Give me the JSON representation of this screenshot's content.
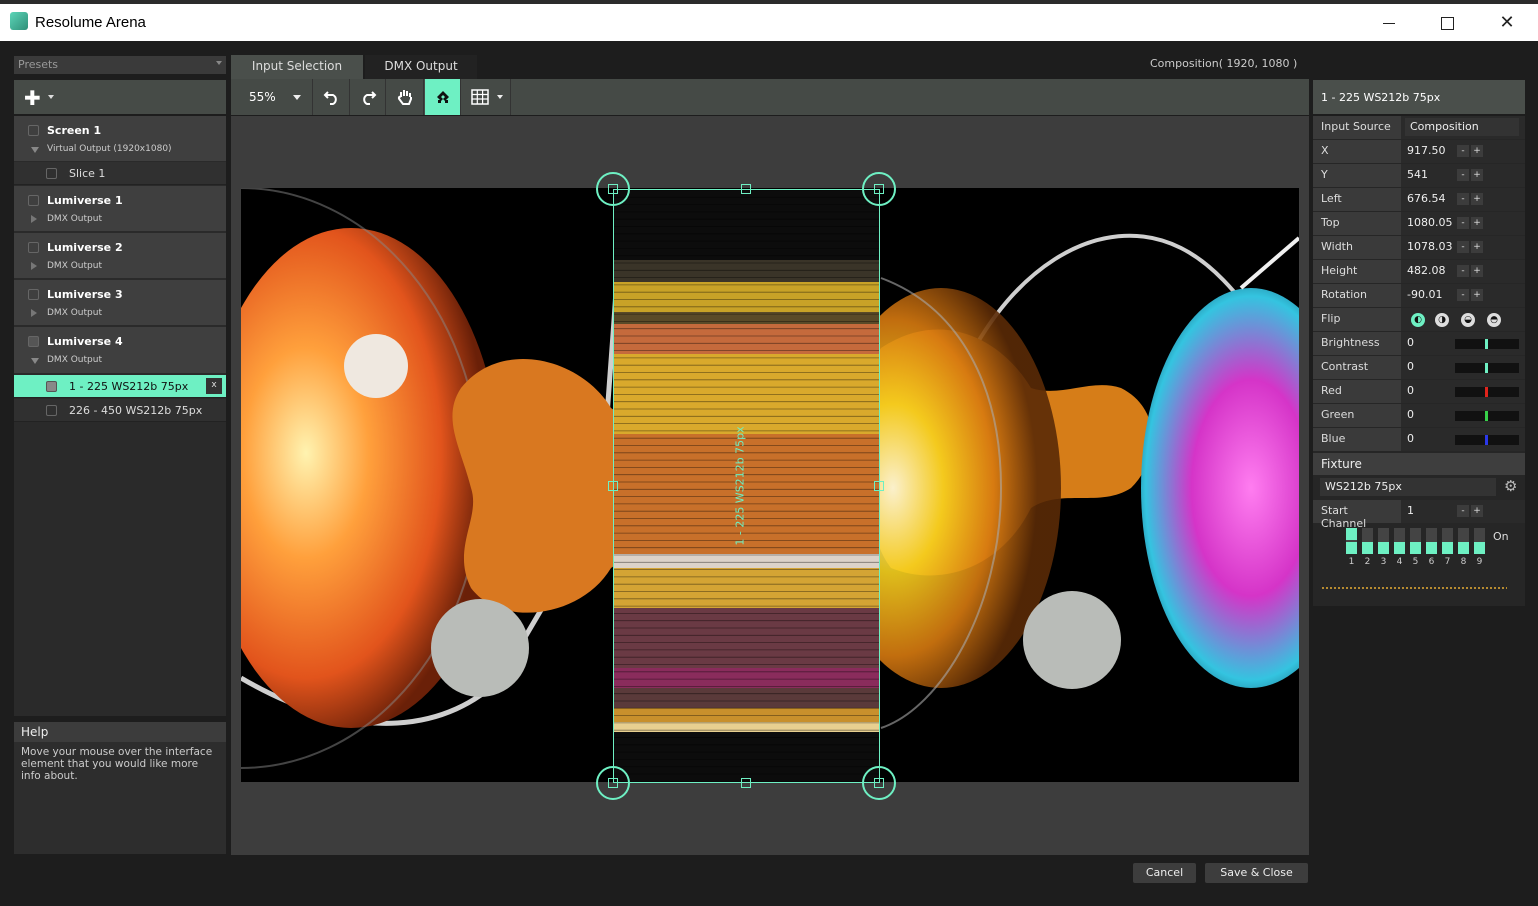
{
  "window": {
    "title": "Resolume Arena"
  },
  "left": {
    "presets": "Presets",
    "tree": [
      {
        "name": "Screen 1",
        "sub": "Virtual Output (1920x1080)",
        "expanded": true
      },
      {
        "name": "Lumiverse 1",
        "sub": "DMX Output",
        "expanded": false
      },
      {
        "name": "Lumiverse 2",
        "sub": "DMX Output",
        "expanded": false
      },
      {
        "name": "Lumiverse 3",
        "sub": "DMX Output",
        "expanded": false
      },
      {
        "name": "Lumiverse 4",
        "sub": "DMX Output",
        "expanded": true
      }
    ],
    "slices": [
      "Slice 1",
      "1 - 225 WS212b 75px",
      "226 - 450 WS212b 75px"
    ],
    "remove_label": "x"
  },
  "help": {
    "title": "Help",
    "text": "Move your mouse over the interface element that you would like more info about."
  },
  "tabs": {
    "input": "Input Selection",
    "dmx": "DMX Output"
  },
  "composition": "Composition( 1920, 1080 )",
  "toolbar": {
    "zoom": "55%"
  },
  "canvas": {
    "selection_label": "1 - 225 WS212b 75px"
  },
  "props": {
    "title": "1 - 225 WS212b 75px",
    "input_source_label": "Input Source",
    "input_source": "Composition",
    "x_label": "X",
    "x": "917.50",
    "y_label": "Y",
    "y": "541",
    "left_label": "Left",
    "left": "676.54",
    "top_label": "Top",
    "top": "1080.05",
    "width_label": "Width",
    "width": "1078.03",
    "height_label": "Height",
    "height": "482.08",
    "rotation_label": "Rotation",
    "rotation": "-90.01",
    "flip_label": "Flip",
    "brightness_label": "Brightness",
    "brightness": "0",
    "contrast_label": "Contrast",
    "contrast": "0",
    "red_label": "Red",
    "red": "0",
    "green_label": "Green",
    "green": "0",
    "blue_label": "Blue",
    "blue": "0",
    "minus": "-",
    "plus": "+"
  },
  "fixture": {
    "title": "Fixture",
    "name": "WS212b 75px",
    "start_channel_label": "Start Channel",
    "start_channel": "1",
    "channels": [
      "1",
      "2",
      "3",
      "4",
      "5",
      "6",
      "7",
      "8",
      "9"
    ],
    "on_label": "On"
  },
  "buttons": {
    "cancel": "Cancel",
    "save": "Save & Close"
  },
  "colors": {
    "accent": "#6ef0c3",
    "red": "#e0241c",
    "green": "#38d14a",
    "blue": "#2b38e8"
  }
}
